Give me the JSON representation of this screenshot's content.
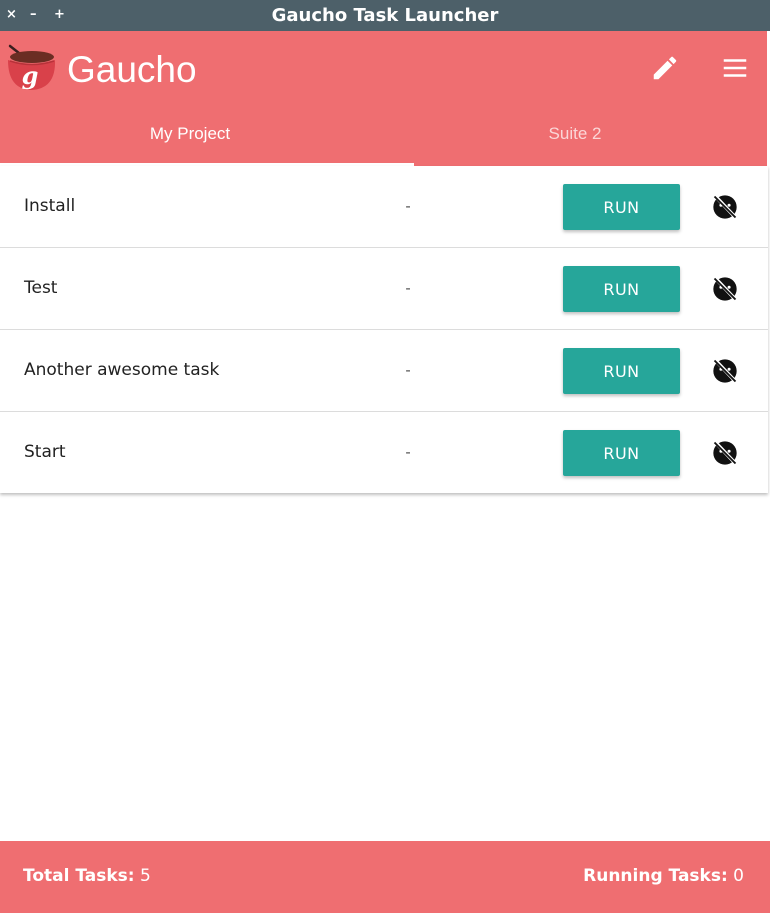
{
  "window": {
    "title": "Gaucho Task Launcher",
    "controls": {
      "close": "×",
      "minimize": "–",
      "maximize": "+"
    }
  },
  "header": {
    "brand": "Gaucho",
    "logo_icon": "gaucho-mate-logo",
    "actions": [
      {
        "icon": "pencil-icon"
      },
      {
        "icon": "hamburger-menu-icon"
      }
    ],
    "tabs": [
      {
        "label": "My Project",
        "active": true
      },
      {
        "label": "Suite 2",
        "active": false
      }
    ]
  },
  "tasks": [
    {
      "name": "Install",
      "status": "-",
      "button_label": "RUN",
      "icon": "disabled-schedule-icon"
    },
    {
      "name": "Test",
      "status": "-",
      "button_label": "RUN",
      "icon": "disabled-schedule-icon"
    },
    {
      "name": "Another awesome task",
      "status": "-",
      "button_label": "RUN",
      "icon": "disabled-schedule-icon"
    },
    {
      "name": "Start",
      "status": "-",
      "button_label": "RUN",
      "icon": "disabled-schedule-icon"
    }
  ],
  "footer": {
    "total_label": "Total Tasks:",
    "total_value": "5",
    "running_label": "Running Tasks:",
    "running_value": "0"
  },
  "colors": {
    "titlebar": "#4d6069",
    "primary": "#ef6e71",
    "run_button": "#26a69a"
  }
}
